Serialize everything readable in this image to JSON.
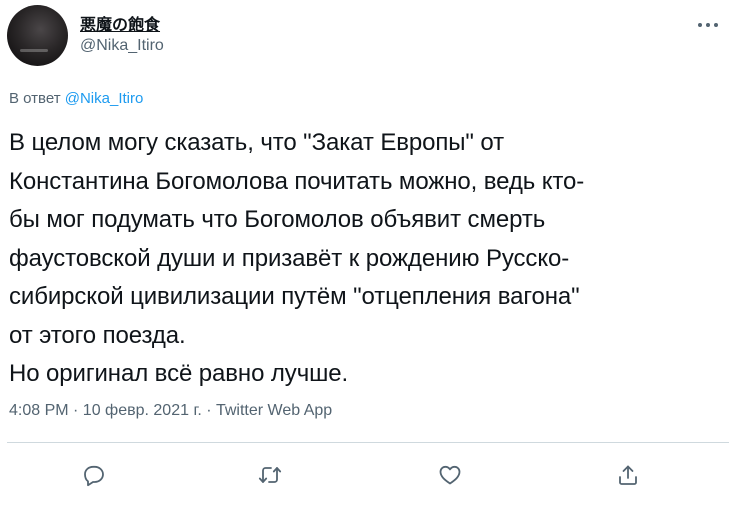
{
  "author": {
    "display_name": "悪魔の飽食",
    "handle": "@Nika_Itiro"
  },
  "reply": {
    "prefix": "В ответ ",
    "to_handle": "@Nika_Itiro"
  },
  "tweet": {
    "text": "В целом могу сказать, что \"Закат Европы\" от\nКонстантина Богомолова почитать можно, ведь кто-\nбы мог подумать что Богомолов объявит смерть\nфаустовской души и призавёт к рождению Русско-\nсибирской цивилизации путём \"отцепления вагона\"\nот этого поезда.\nНо оригинал всё равно лучше."
  },
  "meta": {
    "line": "4:08 PM · 10 февр. 2021 г. · Twitter Web App"
  },
  "icons": {
    "more": "more-horizontal-icon",
    "reply": "reply-icon",
    "retweet": "retweet-icon",
    "like": "heart-icon",
    "share": "share-icon"
  },
  "colors": {
    "text": "#0f1419",
    "secondary": "#536471",
    "link": "#1d9bf0",
    "divider": "#cfd9de"
  }
}
